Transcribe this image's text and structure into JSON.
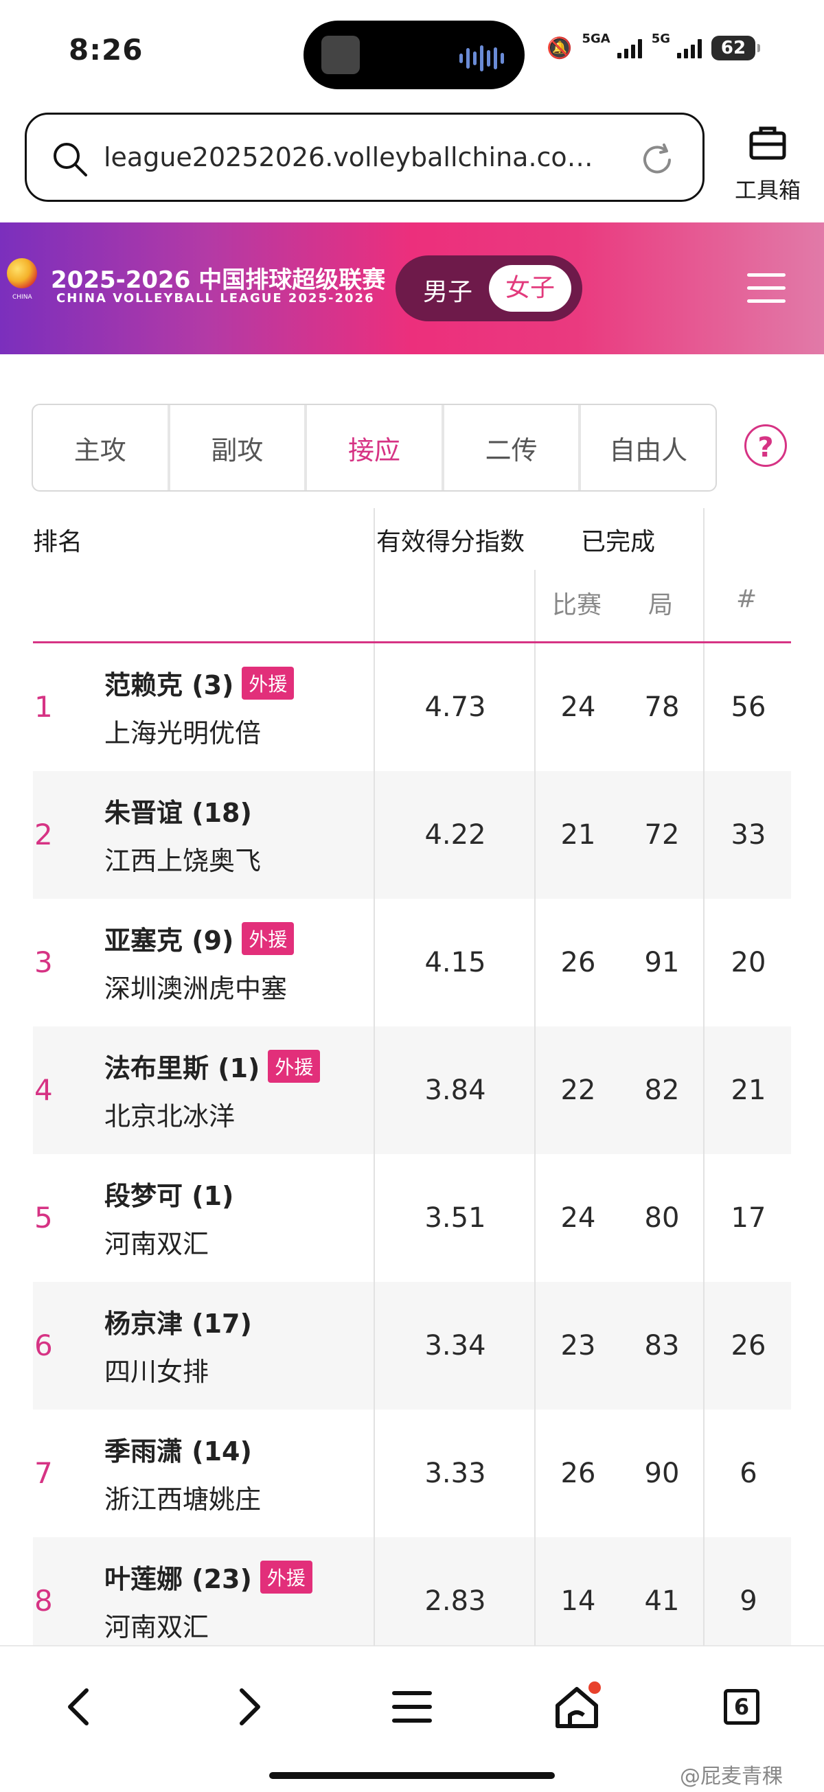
{
  "status": {
    "time": "8:26",
    "sig1": "5GA",
    "sig2": "5G",
    "battery": "62"
  },
  "browser": {
    "url": "league20252026.volleyballchina.co…",
    "toolbox_label": "工具箱"
  },
  "header": {
    "title": "2025-2026 中国排球超级联赛",
    "subtitle": "CHINA VOLLEYBALL LEAGUE 2025-2026",
    "logo_text": "CHINA",
    "male": "男子",
    "female": "女子",
    "accent": "#d63384"
  },
  "tabs": [
    "主攻",
    "副攻",
    "接应",
    "二传",
    "自由人"
  ],
  "active_tab": "接应",
  "help": "?",
  "table": {
    "col_rank": "排名",
    "col_index": "有效得分指数",
    "col_done": "已完成",
    "col_matches": "比赛",
    "col_sets": "局",
    "col_num": "#",
    "rows": [
      {
        "rank": "1",
        "name": "范赖克 (3)",
        "foreign": "外援",
        "team": "上海光明优倍",
        "index": "4.73",
        "matches": "24",
        "sets": "78",
        "num": "56"
      },
      {
        "rank": "2",
        "name": "朱晋谊 (18)",
        "foreign": "",
        "team": "江西上饶奥飞",
        "index": "4.22",
        "matches": "21",
        "sets": "72",
        "num": "33"
      },
      {
        "rank": "3",
        "name": "亚塞克 (9)",
        "foreign": "外援",
        "team": "深圳澳洲虎中塞",
        "index": "4.15",
        "matches": "26",
        "sets": "91",
        "num": "20"
      },
      {
        "rank": "4",
        "name": "法布里斯 (1)",
        "foreign": "外援",
        "team": "北京北冰洋",
        "index": "3.84",
        "matches": "22",
        "sets": "82",
        "num": "21"
      },
      {
        "rank": "5",
        "name": "段梦可 (1)",
        "foreign": "",
        "team": "河南双汇",
        "index": "3.51",
        "matches": "24",
        "sets": "80",
        "num": "17"
      },
      {
        "rank": "6",
        "name": "杨京津 (17)",
        "foreign": "",
        "team": "四川女排",
        "index": "3.34",
        "matches": "23",
        "sets": "83",
        "num": "26"
      },
      {
        "rank": "7",
        "name": "季雨潇 (14)",
        "foreign": "",
        "team": "浙江西塘姚庄",
        "index": "3.33",
        "matches": "26",
        "sets": "90",
        "num": "6"
      },
      {
        "rank": "8",
        "name": "叶莲娜 (23)",
        "foreign": "外援",
        "team": "河南双汇",
        "index": "2.83",
        "matches": "14",
        "sets": "41",
        "num": "9"
      }
    ]
  },
  "bottom": {
    "tabs_count": "6",
    "watermark": "@屁麦青稞"
  }
}
